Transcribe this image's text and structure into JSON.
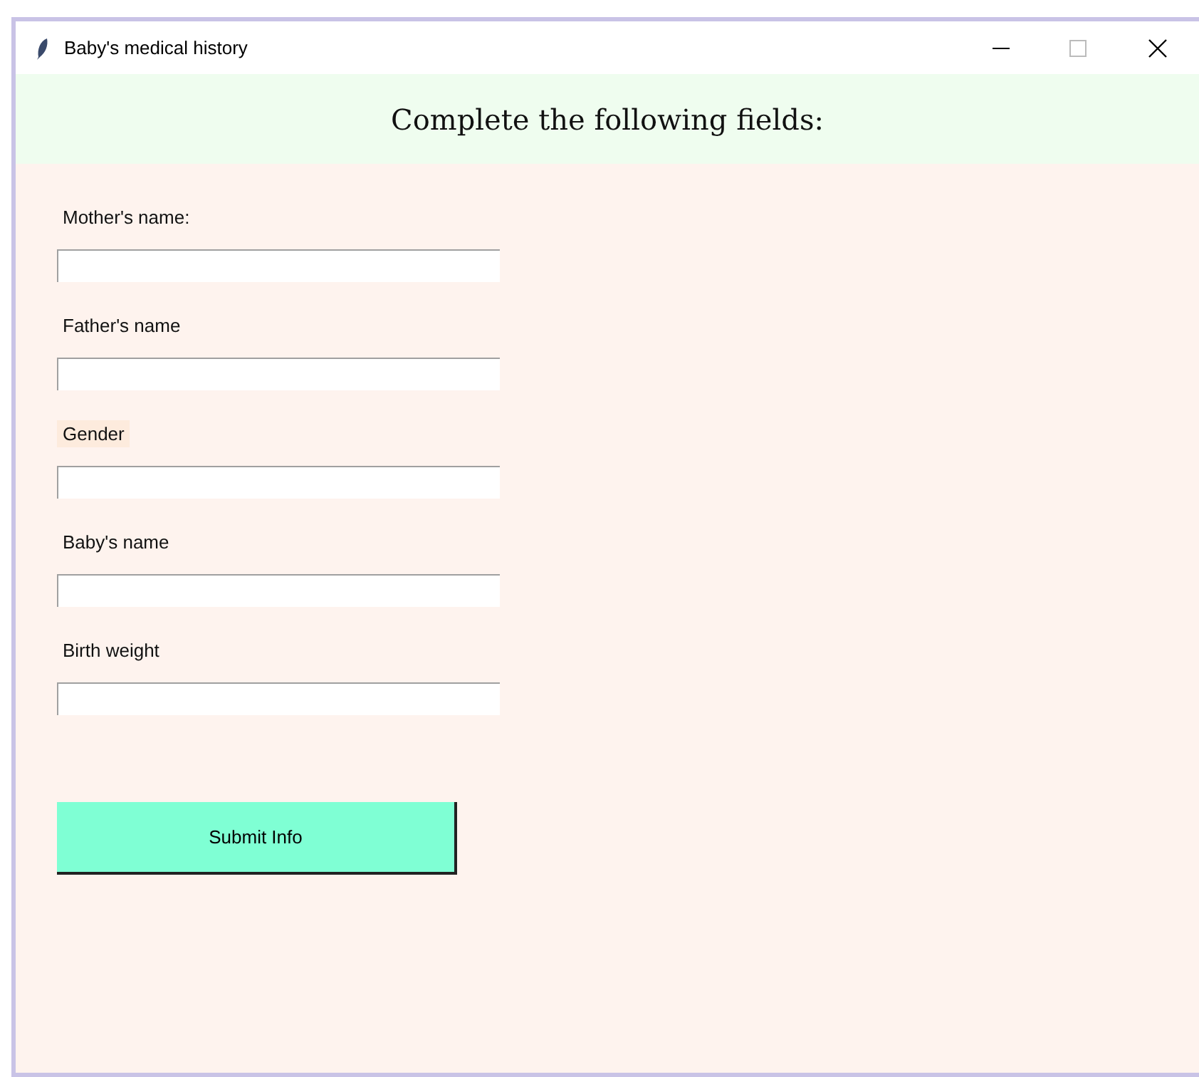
{
  "window": {
    "title": "Baby's medical history"
  },
  "heading": "Complete the following fields:",
  "fields": [
    {
      "label": "Mother's name:",
      "highlighted": false
    },
    {
      "label": "Father's name",
      "highlighted": false
    },
    {
      "label": "Gender",
      "highlighted": true
    },
    {
      "label": "Baby's name",
      "highlighted": false
    },
    {
      "label": "Birth weight",
      "highlighted": false
    }
  ],
  "submit_button": "Submit Info"
}
